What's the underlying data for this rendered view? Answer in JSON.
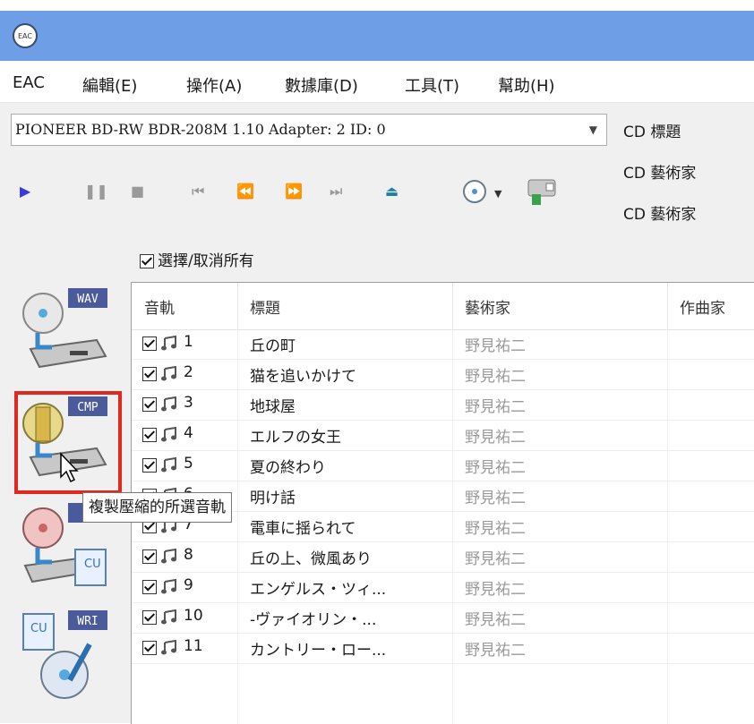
{
  "titlebar": {
    "icon_text": "EAC"
  },
  "menu": [
    {
      "label": "EAC"
    },
    {
      "label": "編輯(E)"
    },
    {
      "label": "操作(A)"
    },
    {
      "label": "數據庫(D)"
    },
    {
      "label": "工具(T)"
    },
    {
      "label": "幫助(H)"
    }
  ],
  "drive": {
    "value": "PIONEER BD-RW   BDR-208M 1.10  Adapter: 2  ID: 0"
  },
  "cd_labels": {
    "title": "CD 標題",
    "artist1": "CD 藝術家",
    "artist2": "CD 藝術家"
  },
  "select_all": "選擇/取消所有",
  "columns": {
    "track": "音軌",
    "title": "標題",
    "artist": "藝術家",
    "composer": "作曲家"
  },
  "tracks": [
    {
      "num": "1",
      "title": "丘の町",
      "artist": "野見祐二"
    },
    {
      "num": "2",
      "title": "猫を追いかけて",
      "artist": "野見祐二"
    },
    {
      "num": "3",
      "title": "地球屋",
      "artist": "野見祐二"
    },
    {
      "num": "4",
      "title": "エルフの女王",
      "artist": "野見祐二"
    },
    {
      "num": "5",
      "title": "夏の終わり",
      "artist": "野見祐二"
    },
    {
      "num": "6",
      "title": "明け話",
      "artist": "野見祐二"
    },
    {
      "num": "7",
      "title": "電車に揺られて",
      "artist": "野見祐二"
    },
    {
      "num": "8",
      "title": "丘の上、微風あり",
      "artist": "野見祐二"
    },
    {
      "num": "9",
      "title": "エンゲルス・ツィ...",
      "artist": "野見祐二"
    },
    {
      "num": "10",
      "title": "-ヴァイオリン・...",
      "artist": "野見祐二"
    },
    {
      "num": "11",
      "title": "カントリー・ロー...",
      "artist": "野見祐二"
    }
  ],
  "side_buttons": {
    "wav": "WAV",
    "cmp": "CMP",
    "img": "I",
    "wri": "WRI"
  },
  "tooltip": "複製壓縮的所選音軌",
  "colors": {
    "titlebar": "#6d9ee6",
    "highlight": "#e0281e",
    "play": "#3a3ad8",
    "eject": "#1e7fa8"
  }
}
